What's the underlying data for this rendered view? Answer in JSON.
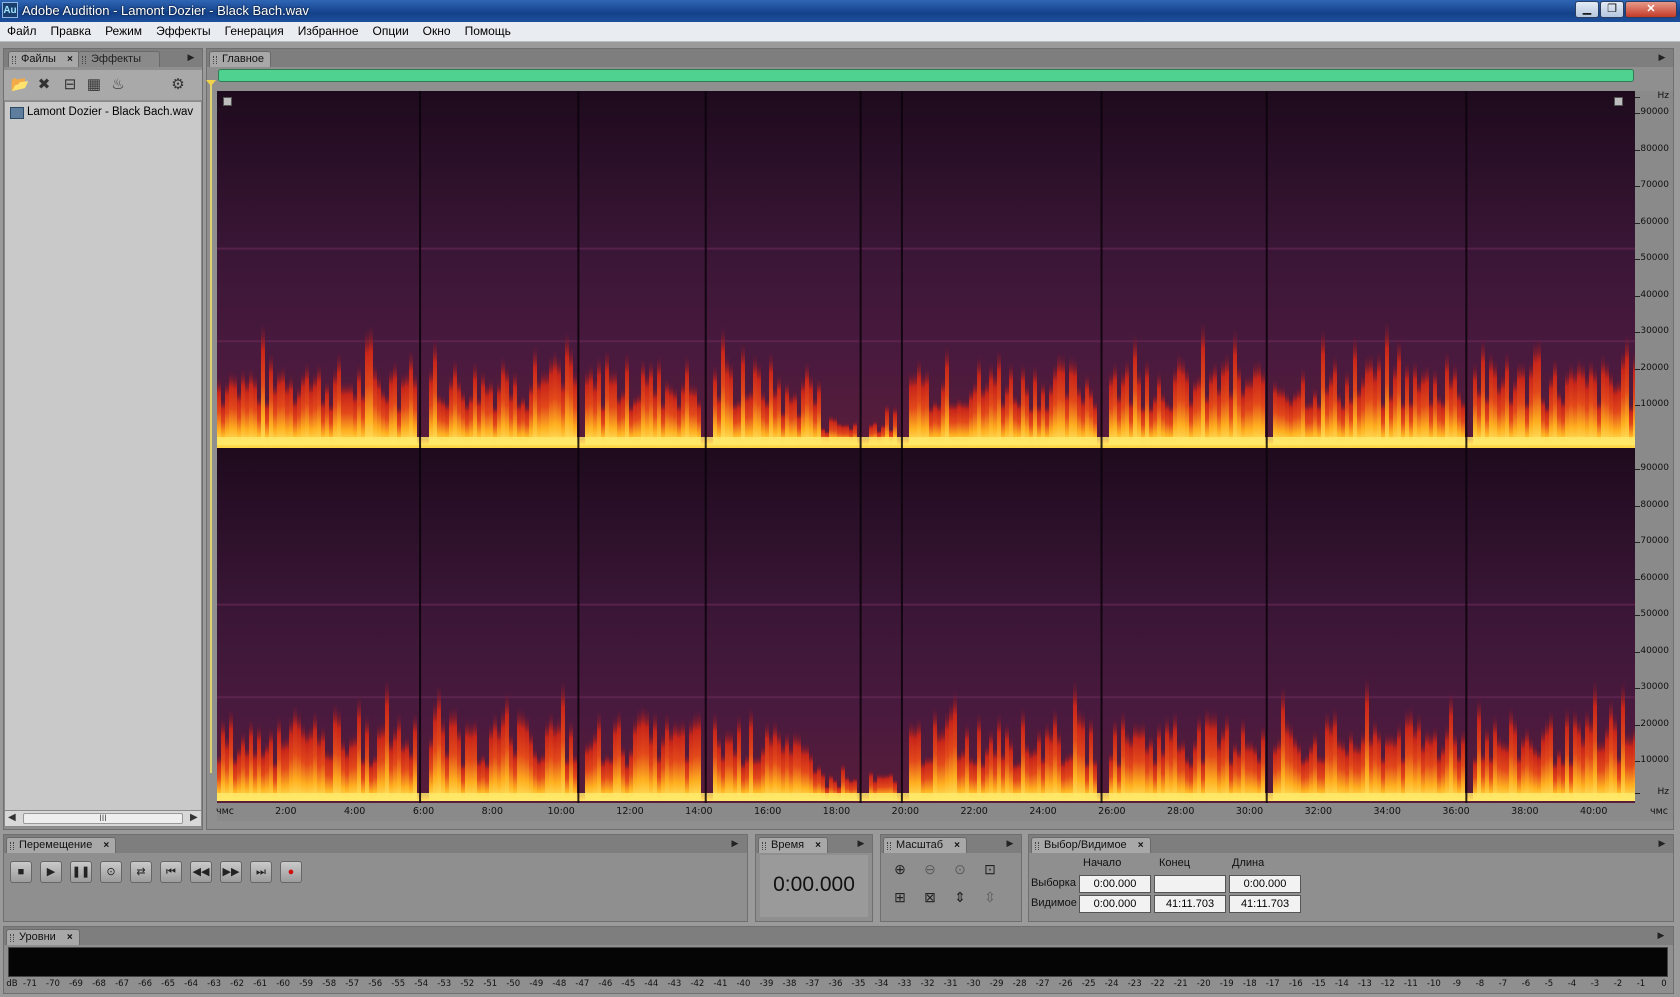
{
  "window": {
    "app_icon": "Au",
    "title": "Adobe Audition - Lamont Dozier - Black Bach.wav",
    "min_glyph": "▁",
    "max_glyph": "❐",
    "close_glyph": "✕"
  },
  "menu": [
    "Файл",
    "Правка",
    "Режим",
    "Эффекты",
    "Генерация",
    "Избранное",
    "Опции",
    "Окно",
    "Помощь"
  ],
  "files_panel": {
    "tabs": [
      "Файлы",
      "Эффекты"
    ],
    "close_glyph": "×",
    "panel_menu_glyph": "▶",
    "toolbar_icons": [
      "open-file-icon",
      "close-file-icon",
      "insert-multitrack-icon",
      "insert-cd-icon",
      "edit-file-icon",
      "autoplay-icon"
    ],
    "toolbar_glyphs": [
      "📂",
      "✖",
      "⊟",
      "▦",
      "♨",
      "⚙"
    ],
    "file_item": "Lamont Dozier - Black Bach.wav",
    "scroll_thumb": "III",
    "scroll_left": "◀",
    "scroll_right": "▶"
  },
  "main_panel": {
    "tab": "Главное",
    "panel_menu_glyph": "▶",
    "freq_unit": "Hz",
    "freq_labels_upper": [
      "90000",
      "80000",
      "70000",
      "60000",
      "50000",
      "40000",
      "30000",
      "20000",
      "10000"
    ],
    "freq_labels_lower": [
      "90000",
      "80000",
      "70000",
      "60000",
      "50000",
      "40000",
      "30000",
      "20000",
      "10000"
    ],
    "freq_unit_bottom": "Hz",
    "time_labels": [
      "чмс",
      "2:00",
      "4:00",
      "6:00",
      "8:00",
      "10:00",
      "12:00",
      "14:00",
      "16:00",
      "18:00",
      "20:00",
      "22:00",
      "24:00",
      "26:00",
      "28:00",
      "30:00",
      "32:00",
      "34:00",
      "36:00",
      "38:00",
      "40:00",
      "чмс"
    ],
    "track_gap_minutes": [
      5.9,
      10.5,
      14.2,
      18.7,
      19.9,
      25.7,
      30.5,
      36.3
    ],
    "total_minutes": 41.2
  },
  "transport": {
    "tab": "Перемещение",
    "close_glyph": "×",
    "panel_menu_glyph": "▶",
    "buttons": [
      "■",
      "▶",
      "❚❚",
      "⊙",
      "⇄",
      "⏮",
      "◀◀",
      "▶▶",
      "⏭",
      "●"
    ]
  },
  "time": {
    "tab": "Время",
    "close_glyph": "×",
    "panel_menu_glyph": "▶",
    "value": "0:00.000"
  },
  "zoom": {
    "tab": "Масштаб",
    "close_glyph": "×",
    "panel_menu_glyph": "▶",
    "buttons": [
      "⊕",
      "⊖",
      "⊙",
      "⊡",
      "⊞",
      "⊠",
      "⇕",
      "⇳"
    ]
  },
  "selection": {
    "tab": "Выбор/Видимое",
    "close_glyph": "×",
    "panel_menu_glyph": "▶",
    "headers": [
      "Начало",
      "Конец",
      "Длина"
    ],
    "rows": [
      {
        "label": "Выборка",
        "start": "0:00.000",
        "end": "",
        "length": "0:00.000"
      },
      {
        "label": "Видимое",
        "start": "0:00.000",
        "end": "41:11.703",
        "length": "41:11.703"
      }
    ]
  },
  "levels": {
    "tab": "Уровни",
    "close_glyph": "×",
    "panel_menu_glyph": "▶",
    "unit": "dB",
    "scale": [
      "-71",
      "-70",
      "-69",
      "-68",
      "-67",
      "-66",
      "-65",
      "-64",
      "-63",
      "-62",
      "-61",
      "-60",
      "-59",
      "-58",
      "-57",
      "-56",
      "-55",
      "-54",
      "-53",
      "-52",
      "-51",
      "-50",
      "-49",
      "-48",
      "-47",
      "-46",
      "-45",
      "-44",
      "-43",
      "-42",
      "-41",
      "-40",
      "-39",
      "-38",
      "-37",
      "-36",
      "-35",
      "-34",
      "-33",
      "-32",
      "-31",
      "-30",
      "-29",
      "-28",
      "-27",
      "-26",
      "-25",
      "-24",
      "-23",
      "-22",
      "-21",
      "-20",
      "-19",
      "-18",
      "-17",
      "-16",
      "-15",
      "-14",
      "-13",
      "-12",
      "-11",
      "-10",
      "-9",
      "-8",
      "-7",
      "-6",
      "-5",
      "-4",
      "-3",
      "-2",
      "-1",
      "0"
    ]
  },
  "colors": {
    "spectrogram_low": "#2a0f26",
    "spectrogram_mid": "#c8261a",
    "spectrogram_high": "#ffe96a",
    "overview_bar": "#4fd28f",
    "playhead": "#f0d34a"
  }
}
